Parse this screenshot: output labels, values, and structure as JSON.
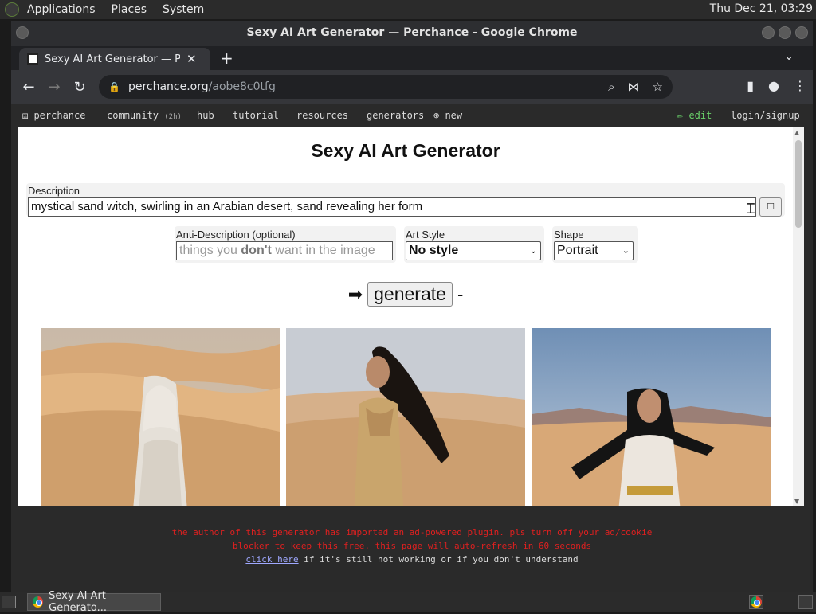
{
  "panel": {
    "applications": "Applications",
    "places": "Places",
    "system": "System",
    "clock": "Thu Dec 21, 03:29"
  },
  "window": {
    "title": "Sexy AI Art Generator — Perchance - Google Chrome"
  },
  "tab": {
    "title": "Sexy AI Art Generator — Perchance",
    "close": "✕",
    "new_tab": "+"
  },
  "omnibox": {
    "host": "perchance.org",
    "path": "/aobe8c0tfg"
  },
  "site_nav": {
    "logo": "⚄ perchance",
    "community": "community",
    "community_badge": "(2h)",
    "hub": "hub",
    "tutorial": "tutorial",
    "resources": "resources",
    "generators": "generators",
    "new": "⊕ new",
    "edit": "✏ edit",
    "login": "login/signup"
  },
  "generator": {
    "title": "Sexy AI Art Generator",
    "description_label": "Description",
    "description_value": "mystical sand witch, swirling in an Arabian desert, sand revealing her form",
    "anti_label": "Anti-Description (optional)",
    "anti_placeholder_pre": "things you ",
    "anti_placeholder_bold": "don't",
    "anti_placeholder_post": " want in the image",
    "art_style_label": "Art Style",
    "art_style_value": "No style",
    "shape_label": "Shape",
    "shape_value": "Portrait",
    "generate_prefix": "➡",
    "generate_label": "generate",
    "generate_suffix": "-"
  },
  "notice": {
    "line1": "the author of this generator has imported an ad-powered plugin. pls turn off your ad/cookie",
    "line2": "blocker to keep this free. this page will auto-refresh in 60 seconds",
    "link": "click here",
    "line3": " if it's still not working or if you don't understand"
  },
  "taskbar": {
    "task_label": "Sexy AI Art Generato..."
  },
  "colors": {
    "notice_red": "#e02020",
    "edit_green": "#6ad26a",
    "page_bg": "#2a2a2a"
  }
}
